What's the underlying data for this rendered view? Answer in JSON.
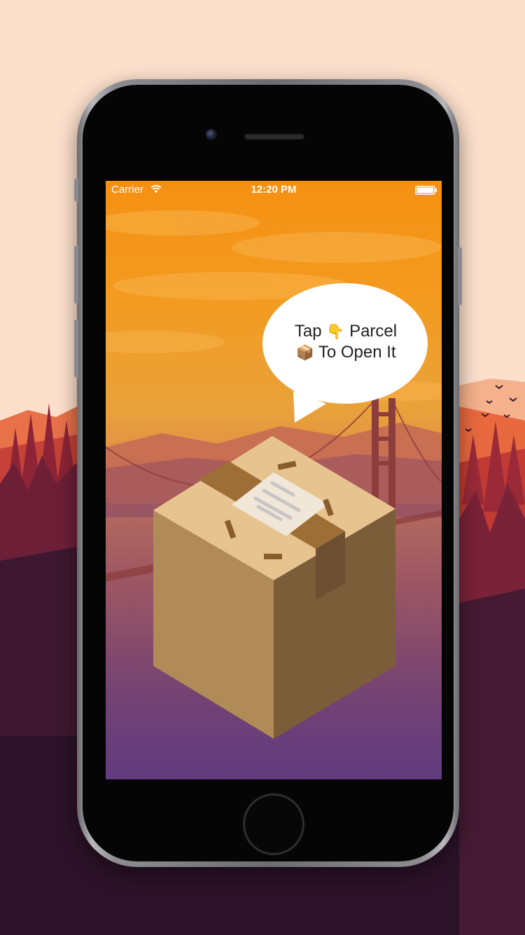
{
  "status_bar": {
    "carrier": "Carrier",
    "time": "12:20 PM"
  },
  "bubble": {
    "line1_word1": "Tap",
    "line1_emoji": "👇",
    "line1_word2": "Parcel",
    "line2_emoji": "📦",
    "line2_text": "To Open It"
  },
  "colors": {
    "sky_top": "#f59012",
    "sky_bottom": "#553585",
    "box_top": "#e7c48f",
    "box_left": "#b08b57",
    "box_right": "#7c5d3a",
    "tape": "#9d6f37",
    "label": "#f1e7d8"
  },
  "icons": [
    "wifi-icon",
    "battery-icon"
  ]
}
